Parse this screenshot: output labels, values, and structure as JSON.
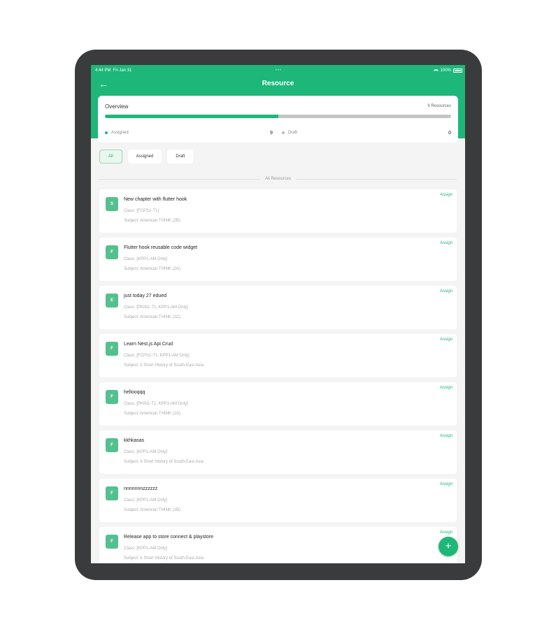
{
  "colors": {
    "accent": "#1db77a",
    "device": "#3a3b3d",
    "avatar": "#55c08f",
    "track": "#c4c6c5",
    "draft_dot": "#bbbbbb"
  },
  "status_bar": {
    "time": "4:44 PM",
    "date": "Fri Jan 31",
    "battery": "100%"
  },
  "header": {
    "back_icon": "back-arrow-icon",
    "title": "Resource"
  },
  "overview": {
    "title": "Overview",
    "count": "9 Resources",
    "assigned_fraction": 0.5,
    "assigned_label": "Assigned",
    "assigned_value": "9",
    "draft_label": "Draft",
    "draft_value": "0"
  },
  "filters": [
    {
      "label": "All",
      "active": true
    },
    {
      "label": "Assigned",
      "active": false
    },
    {
      "label": "Draft",
      "active": false
    }
  ],
  "section_label": "All Resources",
  "resources": [
    {
      "avatar": "S",
      "title": "New chapter with flutter hook",
      "class": "Class: [FCPS1-T1]",
      "subject": "Subject: American THINK (2B)",
      "action": "Assign"
    },
    {
      "avatar": "F",
      "title": "Flutter hook reusable code widget",
      "class": "Class: [KPP1-AM Only]",
      "subject": "Subject: American THINK (2A)",
      "action": "Assign"
    },
    {
      "avatar": "E",
      "title": "just today 27 edued",
      "class": "Class: [PKIN1-T1, KPP1-AM Only]",
      "subject": "Subject: American THINK (1C)",
      "action": "Assign"
    },
    {
      "avatar": "F",
      "title": "Learn Nest.js Api Crud",
      "class": "Class: [FCPS1-T1, KPP1-AM Only]",
      "subject": "Subject: A Short History of South-East Asia",
      "action": "Assign"
    },
    {
      "avatar": "F",
      "title": "hellooqqq",
      "class": "Class: [PKIN1-T1, KPP1-AM Only]",
      "subject": "Subject: American THINK (1A)",
      "action": "Assign"
    },
    {
      "avatar": "F",
      "title": "kkhkasas",
      "class": "Class: [KPP1-AM Only]",
      "subject": "Subject: A Short History of South-East Asia",
      "action": "Assign"
    },
    {
      "avatar": "F",
      "title": "nnnnnnnzzzzzz",
      "class": "Class: [KPP1-AM Only]",
      "subject": "Subject: American THINK (1B)",
      "action": "Assign"
    },
    {
      "avatar": "F",
      "title": "Release app to store connect & playstore",
      "class": "Class: [KPP1-AM Only]",
      "subject": "Subject: A Short History of South-East Asia",
      "action": "Assign"
    }
  ],
  "fab": {
    "icon": "plus-icon",
    "symbol": "+"
  }
}
